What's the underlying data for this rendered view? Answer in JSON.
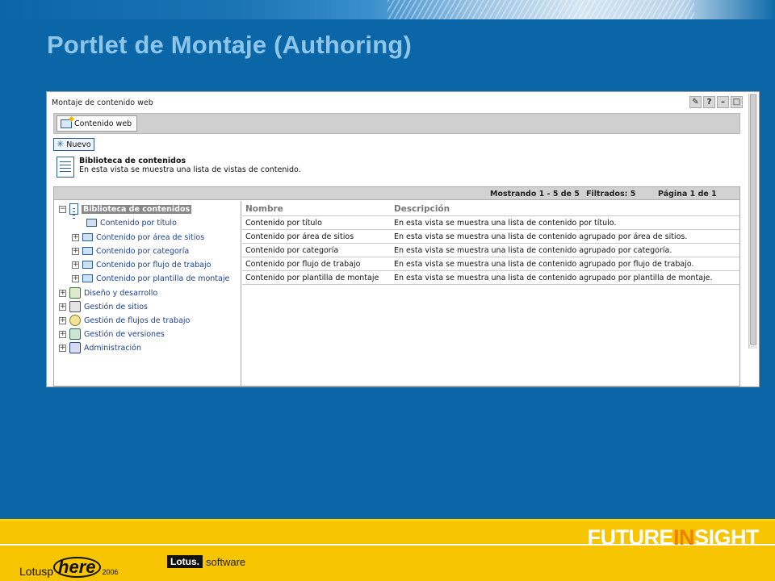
{
  "slide": {
    "title": "Portlet de Montaje (Authoring)"
  },
  "portlet": {
    "title": "Montaje de contenido web",
    "controls": {
      "edit": "✎",
      "help": "?",
      "minimize": "–",
      "maximize": "□"
    }
  },
  "tabs": [
    {
      "label": "Contenido web"
    }
  ],
  "toolbar": {
    "new_label": "Nuevo"
  },
  "library": {
    "title": "Biblioteca de contenidos",
    "description": "En esta vista se muestra una lista de vistas de contenido."
  },
  "status": {
    "showing": "Mostrando 1 - 5 de 5",
    "filtered": "Filtrados: 5",
    "page": "Página 1 de 1"
  },
  "tree": {
    "root": "Biblioteca de contenidos",
    "views": [
      "Contenido por título",
      "Contenido por área de sitios",
      "Contenido por categoría",
      "Contenido por flujo de trabajo",
      "Contenido por plantilla de montaje"
    ],
    "nodes": [
      "Diseño y desarrollo",
      "Gestión de sitios",
      "Gestión de flujos de trabajo",
      "Gestión de versiones",
      "Administración"
    ]
  },
  "table": {
    "headers": {
      "name": "Nombre",
      "description": "Descripción"
    },
    "rows": [
      {
        "name": "Contenido por título",
        "description": "En esta vista se muestra una lista de contenido por título."
      },
      {
        "name": "Contenido por área de sitios",
        "description": "En esta vista se muestra una lista de contenido agrupado por área de sitios."
      },
      {
        "name": "Contenido por categoría",
        "description": "En esta vista se muestra una lista de contenido agrupado por categoría."
      },
      {
        "name": "Contenido por flujo de trabajo",
        "description": "En esta vista se muestra una lista de contenido agrupado por flujo de trabajo."
      },
      {
        "name": "Contenido por plantilla de montaje",
        "description": "En esta vista se muestra una lista de contenido agrupado por plantilla de montaje."
      }
    ]
  },
  "footer": {
    "future_a": "FUTURE",
    "future_b": "IN",
    "future_c": "SIGHT",
    "lotusphere_a": "Lotusp",
    "lotusphere_b": "here",
    "lotusphere_year": "2006",
    "lotus_box": "Lotus.",
    "lotus_software": "software"
  },
  "colors": {
    "slide_background": "#0b66a8",
    "title": "#8ec6ea",
    "footer": "#f6c400",
    "accent_orange": "#f07f00"
  }
}
